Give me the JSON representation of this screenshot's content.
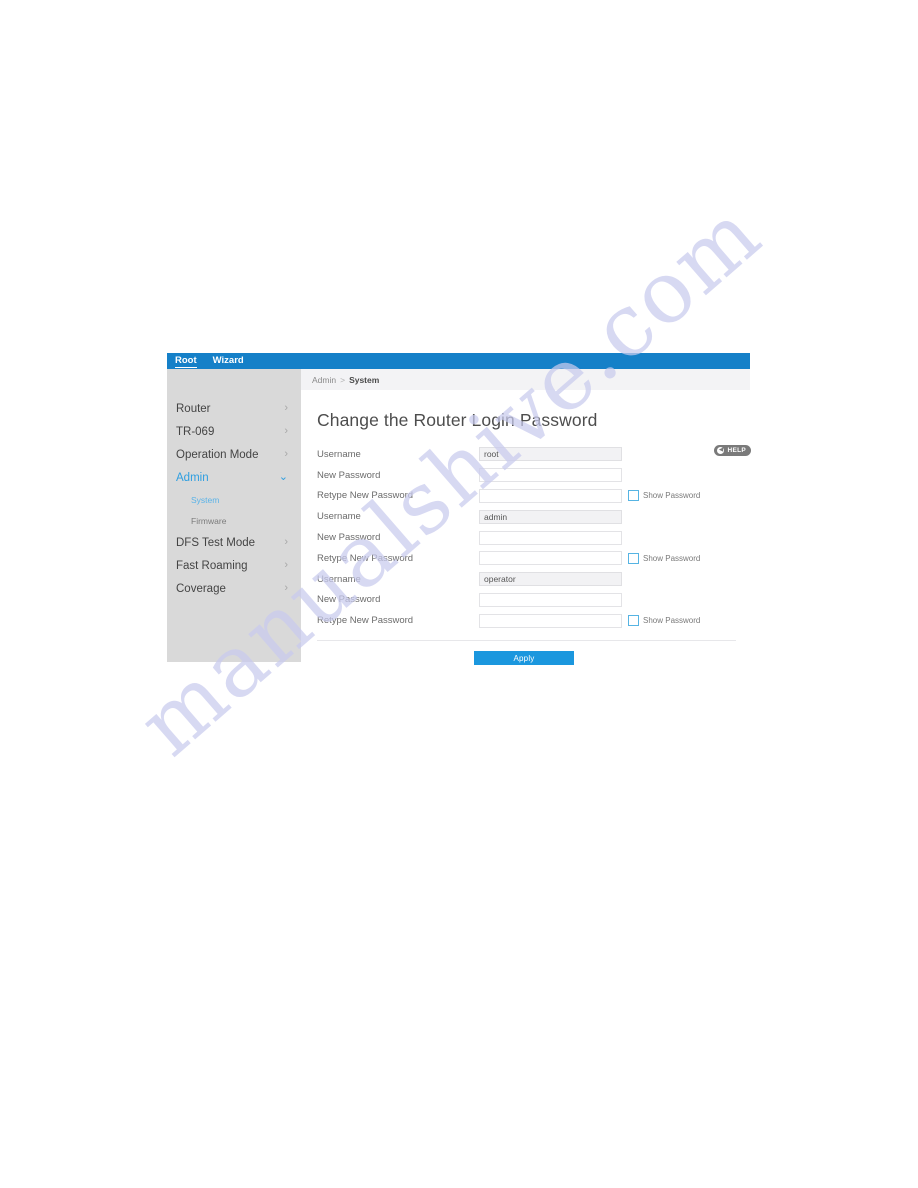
{
  "watermark": {
    "text": "manualshive.com"
  },
  "top_nav": {
    "tabs": [
      {
        "label": "Root",
        "active": true
      },
      {
        "label": "Wizard",
        "active": false
      }
    ]
  },
  "sidebar": {
    "items": [
      {
        "label": "Router",
        "chevron": "›",
        "type": "item"
      },
      {
        "label": "TR-069",
        "chevron": "›",
        "type": "item"
      },
      {
        "label": "Operation Mode",
        "chevron": "›",
        "type": "item"
      },
      {
        "label": "Admin",
        "chevron": "⌄",
        "type": "item-expanded"
      },
      {
        "label": "System",
        "type": "sub-active"
      },
      {
        "label": "Firmware",
        "type": "sub"
      },
      {
        "label": "DFS Test Mode",
        "chevron": "›",
        "type": "item"
      },
      {
        "label": "Fast Roaming",
        "chevron": "›",
        "type": "item"
      },
      {
        "label": "Coverage",
        "chevron": "›",
        "type": "item"
      }
    ]
  },
  "breadcrumb": {
    "parent": "Admin",
    "separator": ">",
    "current": "System"
  },
  "main": {
    "title": "Change the Router Login Password",
    "help": {
      "label": "HELP",
      "icon": "◀"
    },
    "rows": [
      {
        "label": "Username",
        "value": "root",
        "readonly": true,
        "show_password": false
      },
      {
        "label": "New Password",
        "value": "",
        "readonly": false,
        "show_password": false
      },
      {
        "label": "Retype New Password",
        "value": "",
        "readonly": false,
        "show_password": true,
        "show_password_label": "Show Password"
      },
      {
        "label": "Username",
        "value": "admin",
        "readonly": true,
        "show_password": false
      },
      {
        "label": "New Password",
        "value": "",
        "readonly": false,
        "show_password": false
      },
      {
        "label": "Retype New Password",
        "value": "",
        "readonly": false,
        "show_password": true,
        "show_password_label": "Show Password"
      },
      {
        "label": "Username",
        "value": "operator",
        "readonly": true,
        "show_password": false
      },
      {
        "label": "New Password",
        "value": "",
        "readonly": false,
        "show_password": false
      },
      {
        "label": "Retype New Password",
        "value": "",
        "readonly": false,
        "show_password": true,
        "show_password_label": "Show Password"
      }
    ],
    "apply_label": "Apply"
  },
  "colors": {
    "top_nav_blue": "#1580c8",
    "accent_blue": "#2f9fe0",
    "apply_blue": "#1b97de",
    "sidebar_grey": "#d9d9d9",
    "help_grey": "#7a7a7a",
    "checkbox_border": "#56b4e3",
    "watermark_lavender": "#c9cbee"
  }
}
